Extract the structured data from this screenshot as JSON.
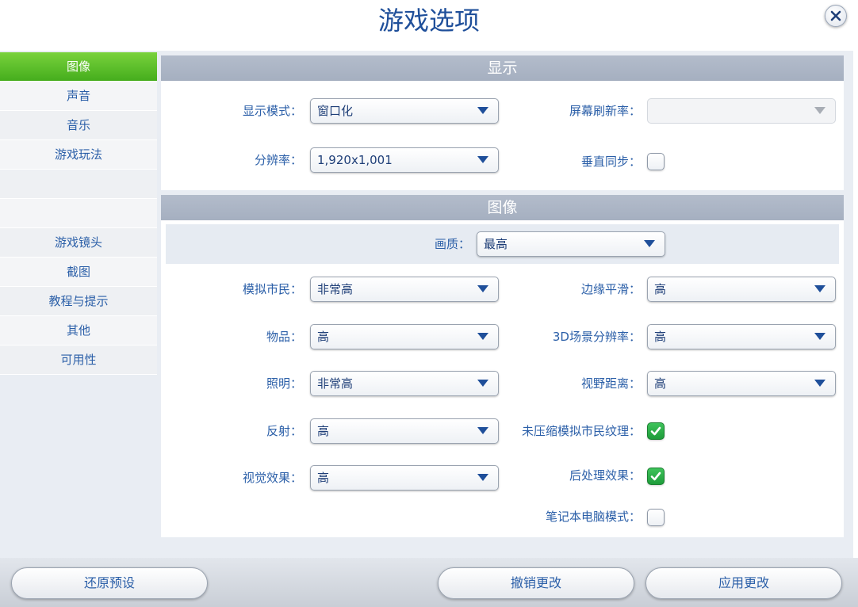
{
  "window": {
    "title": "游戏选项"
  },
  "sidebar": {
    "items": [
      {
        "label": "图像",
        "active": true
      },
      {
        "label": "声音"
      },
      {
        "label": "音乐"
      },
      {
        "label": "游戏玩法"
      },
      {
        "label": ""
      },
      {
        "label": ""
      },
      {
        "label": "游戏镜头"
      },
      {
        "label": "截图"
      },
      {
        "label": "教程与提示"
      },
      {
        "label": "其他"
      },
      {
        "label": "可用性"
      }
    ]
  },
  "display": {
    "header": "显示",
    "mode_label": "显示模式：",
    "mode_value": "窗口化",
    "resolution_label": "分辨率：",
    "resolution_value": "1,920x1,001",
    "refresh_label": "屏幕刷新率：",
    "refresh_value": "",
    "vsync_label": "垂直同步：",
    "vsync_checked": false
  },
  "graphics": {
    "header": "图像",
    "quality_label": "画质：",
    "quality_value": "最高",
    "sims_label": "模拟市民：",
    "sims_value": "非常高",
    "objects_label": "物品：",
    "objects_value": "高",
    "lighting_label": "照明：",
    "lighting_value": "非常高",
    "reflection_label": "反射：",
    "reflection_value": "高",
    "visual_label": "视觉效果：",
    "visual_value": "高",
    "aa_label": "边缘平滑：",
    "aa_value": "高",
    "scene_res_label": "3D场景分辨率：",
    "scene_res_value": "高",
    "view_dist_label": "视野距离：",
    "view_dist_value": "高",
    "uncompressed_label": "未压缩模拟市民纹理：",
    "uncompressed_checked": true,
    "postfx_label": "后处理效果：",
    "postfx_checked": true,
    "laptop_label": "笔记本电脑模式：",
    "laptop_checked": false
  },
  "footer": {
    "restore_label": "还原预设",
    "cancel_label": "撤销更改",
    "apply_label": "应用更改"
  },
  "colors": {
    "accent_green": "#45ad1d",
    "text_blue": "#2b5fa8",
    "header_gray": "#a5afc0"
  }
}
